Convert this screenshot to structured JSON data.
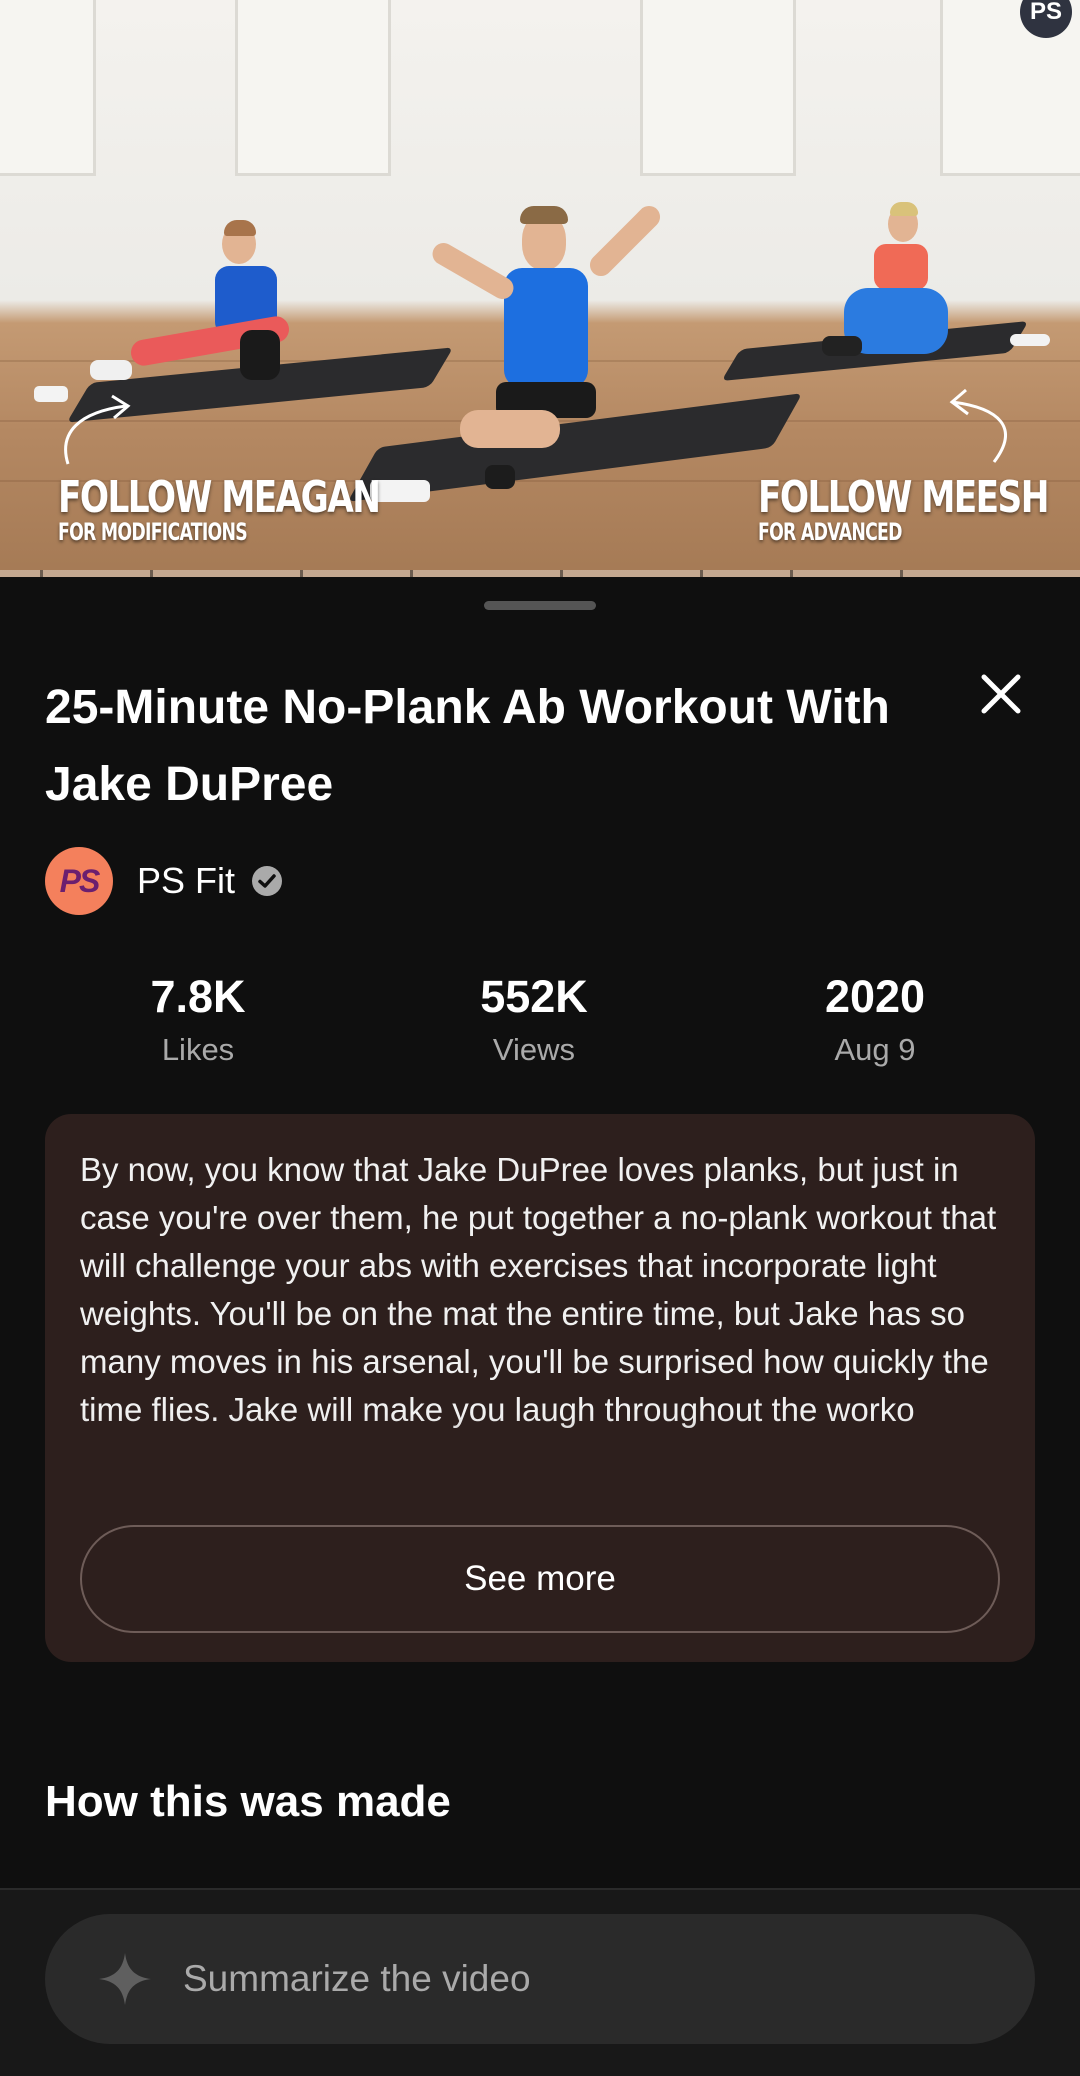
{
  "video": {
    "corner_badge": "PS",
    "overlay_left": {
      "title": "FOLLOW MEAGAN",
      "subtitle": "FOR MODIFICATIONS"
    },
    "overlay_right": {
      "title": "FOLLOW MEESH",
      "subtitle": "FOR ADVANCED"
    }
  },
  "details": {
    "title": "25-Minute No-Plank Ab Workout With Jake DuPree",
    "channel": {
      "avatar_text": "PS",
      "name": "PS Fit",
      "verified": true
    },
    "stats": [
      {
        "value": "7.8K",
        "label": "Likes"
      },
      {
        "value": "552K",
        "label": "Views"
      },
      {
        "value": "2020",
        "label": "Aug 9"
      }
    ],
    "description": "By now, you know that Jake DuPree loves planks, but just in case you're over them, he put together a no-plank workout that will challenge your abs with exercises that incorporate light weights. You'll be on the mat the entire time, but Jake has so many moves in his arsenal, you'll be surprised how quickly the time flies. Jake will make you laugh throughout the worko",
    "see_more_label": "See more",
    "section_heading": "How this was made"
  },
  "summarize": {
    "placeholder": "Summarize the video",
    "icon": "sparkle-icon"
  },
  "colors": {
    "background": "#0f0f0f",
    "description_card": "#2d1f1d",
    "avatar": "#f4805c",
    "muted_text": "#aaaaaa"
  }
}
